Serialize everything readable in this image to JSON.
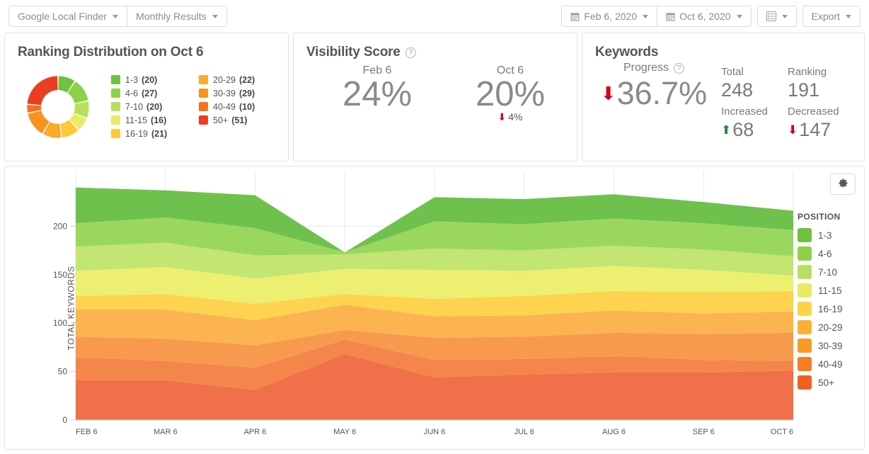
{
  "toolbar": {
    "left_buttons": [
      {
        "label": "Google Local Finder",
        "icon": "chevron-down-icon"
      },
      {
        "label": "Monthly Results",
        "icon": "chevron-down-icon"
      }
    ],
    "start_date": "Feb 6, 2020",
    "end_date": "Oct 6, 2020",
    "view_icon": "list-view-icon",
    "export_label": "Export"
  },
  "ranking_distribution": {
    "title": "Ranking Distribution on Oct 6",
    "legend_col1": [
      {
        "label": "1-3",
        "value": "(20)",
        "color": "#6fc13f"
      },
      {
        "label": "4-6",
        "value": "(27)",
        "color": "#8dd14a"
      },
      {
        "label": "7-10",
        "value": "(20)",
        "color": "#b9e05b"
      },
      {
        "label": "11-15",
        "value": "(16)",
        "color": "#e9ec63"
      },
      {
        "label": "16-19",
        "value": "(21)",
        "color": "#fdc83b"
      }
    ],
    "legend_col2": [
      {
        "label": "20-29",
        "value": "(22)",
        "color": "#fbaa2b"
      },
      {
        "label": "30-39",
        "value": "(29)",
        "color": "#f89320"
      },
      {
        "label": "40-49",
        "value": "(10)",
        "color": "#f4711f"
      },
      {
        "label": "50+",
        "value": "(51)",
        "color": "#ea3d22"
      }
    ]
  },
  "visibility_score": {
    "title": "Visibility Score",
    "help_icon": "question-mark-icon",
    "first": {
      "date": "Feb 6",
      "percent": "24%"
    },
    "second": {
      "date": "Oct 6",
      "percent": "20%",
      "delta": "4%",
      "delta_direction": "down"
    }
  },
  "keywords": {
    "title": "Keywords",
    "progress_label": "Progress",
    "help_icon": "question-mark-icon",
    "progress_value": "36.7%",
    "progress_direction": "down",
    "stats": [
      {
        "label": "Total",
        "value": "248",
        "direction": "none"
      },
      {
        "label": "Ranking",
        "value": "191",
        "direction": "none"
      },
      {
        "label": "Increased",
        "value": "68",
        "direction": "up"
      },
      {
        "label": "Decreased",
        "value": "147",
        "direction": "down"
      }
    ]
  },
  "chart_panel": {
    "settings_icon": "gear-icon",
    "legend_title": "POSITION"
  },
  "chart_data": {
    "type": "area",
    "title": "",
    "xlabel": "",
    "ylabel": "TOTAL KEYWORDS",
    "ylim": [
      0,
      250
    ],
    "yticks": [
      0,
      50,
      100,
      150,
      200
    ],
    "grid": true,
    "legend_position": "right",
    "stacked": true,
    "categories": [
      "FEB 6",
      "MAR 6",
      "APR 6",
      "MAY 6",
      "JUN 6",
      "JUL 6",
      "AUG 6",
      "SEP 6",
      "OCT 6"
    ],
    "series": [
      {
        "name": "50+",
        "color": "#ef7049",
        "values": [
          41,
          41,
          31,
          68,
          44,
          47,
          49,
          49,
          51
        ]
      },
      {
        "name": "40-49",
        "color": "#f4864b",
        "values": [
          24,
          20,
          23,
          15,
          18,
          16,
          17,
          13,
          10
        ]
      },
      {
        "name": "30-39",
        "color": "#f89a4e",
        "values": [
          21,
          23,
          23,
          10,
          23,
          23,
          24,
          27,
          29
        ]
      },
      {
        "name": "20-29",
        "color": "#fbb450",
        "values": [
          28,
          30,
          26,
          26,
          22,
          22,
          23,
          21,
          22
        ]
      },
      {
        "name": "16-19",
        "color": "#fdd34f",
        "values": [
          14,
          16,
          17,
          11,
          18,
          20,
          20,
          22,
          21
        ]
      },
      {
        "name": "11-15",
        "color": "#ecef6f",
        "values": [
          26,
          28,
          26,
          26,
          30,
          26,
          26,
          23,
          16
        ]
      },
      {
        "name": "7-10",
        "color": "#c3e571",
        "values": [
          25,
          25,
          24,
          15,
          22,
          21,
          21,
          21,
          20
        ]
      },
      {
        "name": "4-6",
        "color": "#9ad75f",
        "values": [
          24,
          26,
          28,
          2,
          28,
          27,
          28,
          27,
          27
        ]
      },
      {
        "name": "1-3",
        "color": "#6fc14e",
        "values": [
          37,
          28,
          34,
          0,
          25,
          26,
          25,
          22,
          20
        ]
      }
    ],
    "legend_entries": [
      {
        "label": "1-3",
        "color": "#6fc13f"
      },
      {
        "label": "4-6",
        "color": "#8dd14a"
      },
      {
        "label": "7-10",
        "color": "#b9e05b"
      },
      {
        "label": "11-15",
        "color": "#e9ec63"
      },
      {
        "label": "16-19",
        "color": "#fdd341"
      },
      {
        "label": "20-29",
        "color": "#fcb034"
      },
      {
        "label": "30-39",
        "color": "#f99a28"
      },
      {
        "label": "40-49",
        "color": "#f77d23"
      },
      {
        "label": "50+",
        "color": "#f0601f"
      }
    ]
  }
}
